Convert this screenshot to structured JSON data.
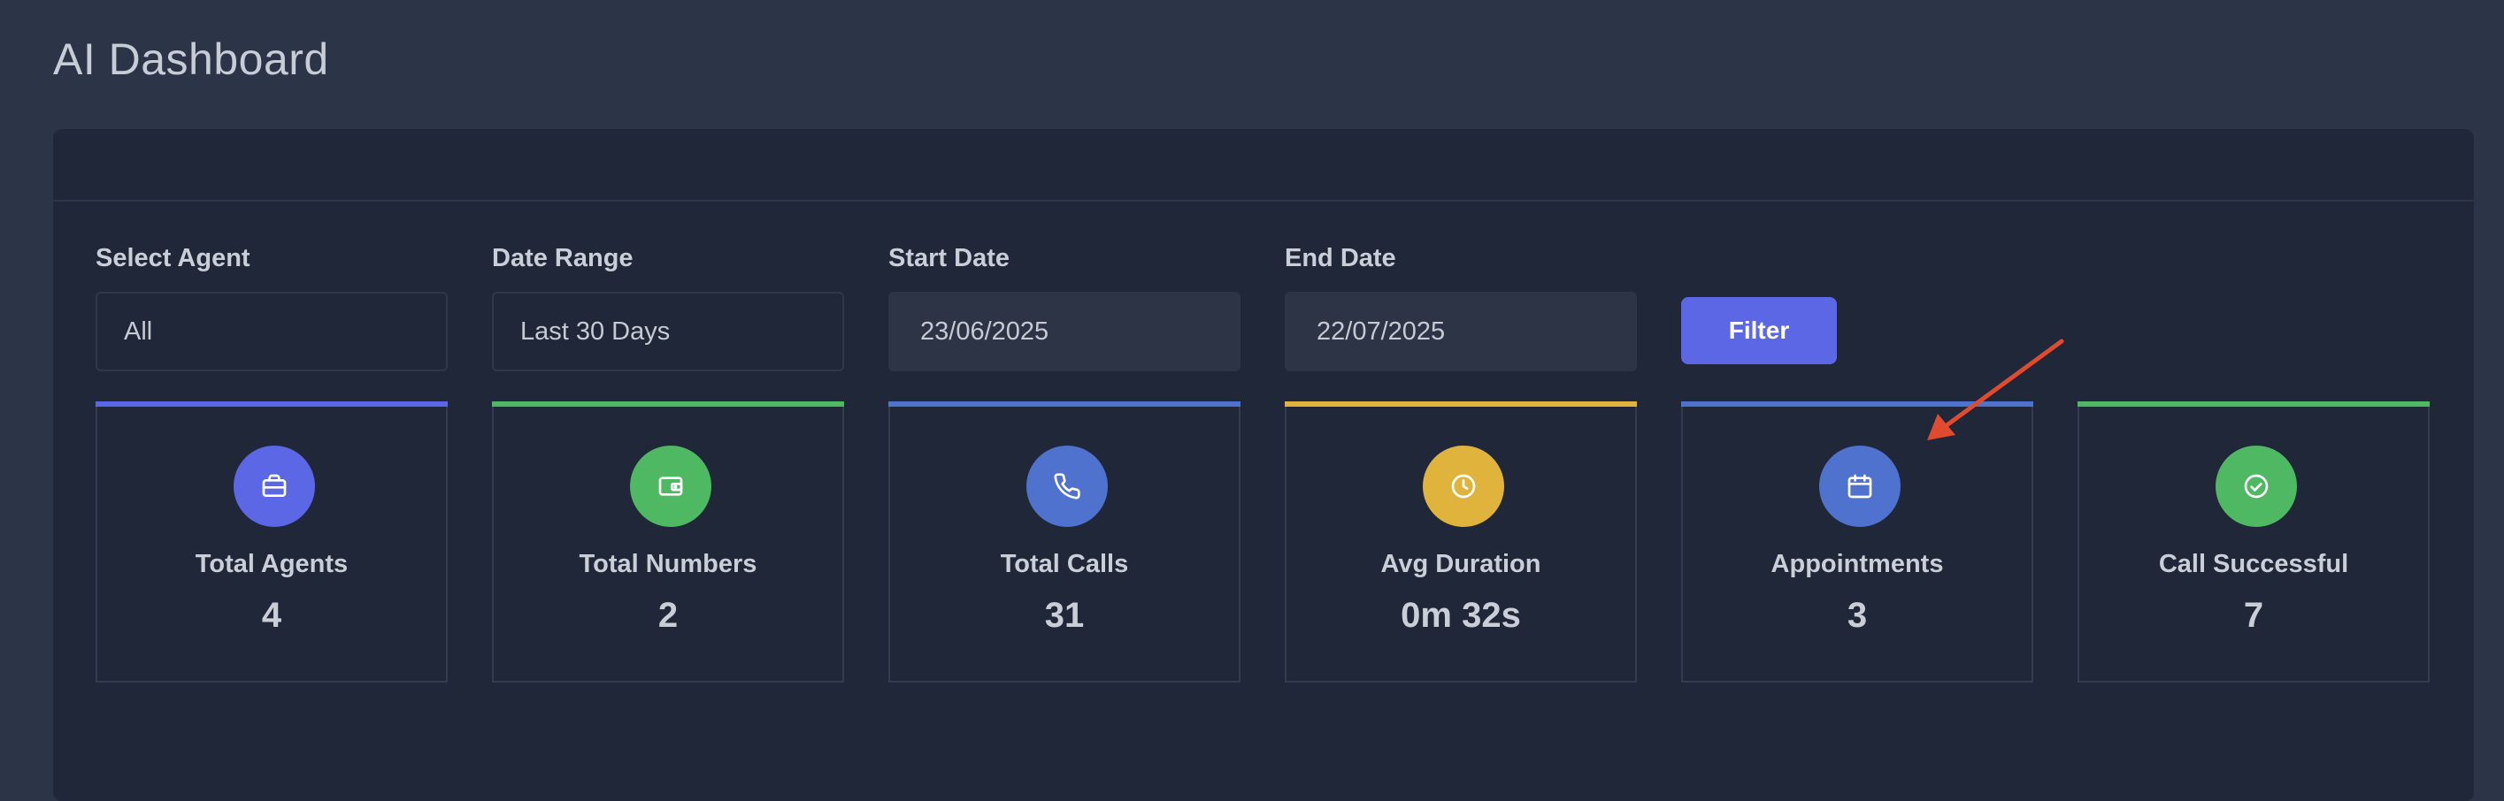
{
  "page": {
    "title": "AI Dashboard"
  },
  "filters": {
    "select_agent": {
      "label": "Select Agent",
      "value": "All"
    },
    "date_range": {
      "label": "Date Range",
      "value": "Last 30 Days"
    },
    "start_date": {
      "label": "Start Date",
      "value": "23/06/2025"
    },
    "end_date": {
      "label": "End Date",
      "value": "22/07/2025"
    },
    "filter_button_label": "Filter"
  },
  "stats": [
    {
      "label": "Total Agents",
      "value": "4",
      "icon": "briefcase-icon",
      "color": "#5c67e6",
      "accent": "#5c67e6"
    },
    {
      "label": "Total Numbers",
      "value": "2",
      "icon": "wallet-icon",
      "color": "#4fb862",
      "accent": "#4fb862"
    },
    {
      "label": "Total Calls",
      "value": "31",
      "icon": "phone-icon",
      "color": "#5072cf",
      "accent": "#5072cf"
    },
    {
      "label": "Avg Duration",
      "value": "0m 32s",
      "icon": "clock-icon",
      "color": "#e0b43c",
      "accent": "#e0b43c"
    },
    {
      "label": "Appointments",
      "value": "3",
      "icon": "calendar-icon",
      "color": "#5072cf",
      "accent": "#5072cf"
    },
    {
      "label": "Call Successful",
      "value": "7",
      "icon": "check-circle-icon",
      "color": "#4fb862",
      "accent": "#4fb862"
    }
  ],
  "colors": {
    "background": "#2b3547",
    "panel": "#1f2738",
    "primary": "#5c67e6",
    "annotation": "#e04a2f"
  }
}
